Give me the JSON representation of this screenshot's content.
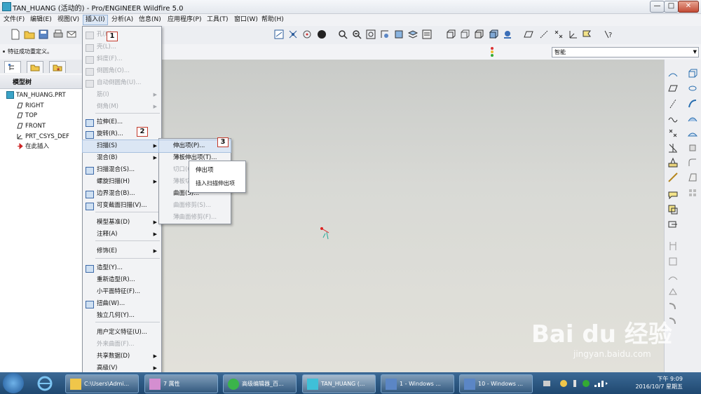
{
  "window": {
    "title": "TAN_HUANG (活动的) - Pro/ENGINEER Wildfire 5.0",
    "min": "—",
    "max": "□",
    "close": "✕"
  },
  "menubar": [
    "文件(F)",
    "编辑(E)",
    "视图(V)",
    "插入(I)",
    "分析(A)",
    "信息(N)",
    "应用程序(P)",
    "工具(T)",
    "窗口(W)",
    "帮助(H)"
  ],
  "status": {
    "message": "特征成功重定义。",
    "filter_value": "智能",
    "filter_arrow": "▼"
  },
  "model_tree": {
    "header": "模型树",
    "items": [
      "TAN_HUANG.PRT",
      "RIGHT",
      "TOP",
      "FRONT",
      "PRT_CSYS_DEF",
      "在此插入"
    ]
  },
  "insert_menu": {
    "items": [
      {
        "label": "孔(H)...",
        "disabled": true,
        "submenu": false,
        "icon": "hole-icon"
      },
      {
        "label": "壳(L)...",
        "disabled": true,
        "submenu": false,
        "icon": "shell-icon"
      },
      {
        "label": "斜度(F)...",
        "disabled": true,
        "submenu": false,
        "icon": "draft-icon"
      },
      {
        "label": "倒圆角(O)...",
        "disabled": true,
        "submenu": false,
        "icon": "round-icon"
      },
      {
        "label": "自动倒圆角(U)...",
        "disabled": true,
        "submenu": false,
        "icon": "auto-round-icon"
      },
      {
        "label": "筋(I)",
        "disabled": true,
        "submenu": true,
        "icon": ""
      },
      {
        "label": "倒角(M)",
        "disabled": true,
        "submenu": true,
        "icon": ""
      },
      {
        "label": "拉伸(E)...",
        "disabled": false,
        "submenu": false,
        "icon": "extrude-icon"
      },
      {
        "label": "旋转(R)...",
        "disabled": false,
        "submenu": false,
        "icon": "revolve-icon"
      },
      {
        "label": "扫描(S)",
        "disabled": false,
        "submenu": true,
        "icon": "",
        "highlight": true
      },
      {
        "label": "混合(B)",
        "disabled": false,
        "submenu": true,
        "icon": ""
      },
      {
        "label": "扫描混合(S)...",
        "disabled": false,
        "submenu": false,
        "icon": "swept-blend-icon"
      },
      {
        "label": "螺旋扫描(H)",
        "disabled": false,
        "submenu": true,
        "icon": ""
      },
      {
        "label": "边界混合(B)...",
        "disabled": false,
        "submenu": false,
        "icon": "boundary-blend-icon"
      },
      {
        "label": "可变截面扫描(V)...",
        "disabled": false,
        "submenu": false,
        "icon": "var-sweep-icon"
      },
      {
        "label": "模型基准(D)",
        "disabled": false,
        "submenu": true,
        "icon": ""
      },
      {
        "label": "注释(A)",
        "disabled": false,
        "submenu": true,
        "icon": ""
      },
      {
        "label": "修饰(E)",
        "disabled": false,
        "submenu": true,
        "icon": ""
      },
      {
        "label": "造型(Y)...",
        "disabled": false,
        "submenu": false,
        "icon": "style-icon"
      },
      {
        "label": "重新造型(R)...",
        "disabled": false,
        "submenu": false,
        "icon": ""
      },
      {
        "label": "小平面特征(F)...",
        "disabled": false,
        "submenu": false,
        "icon": ""
      },
      {
        "label": "扭曲(W)...",
        "disabled": false,
        "submenu": false,
        "icon": "warp-icon"
      },
      {
        "label": "独立几何(Y)...",
        "disabled": false,
        "submenu": false,
        "icon": ""
      },
      {
        "label": "用户定义特征(U)...",
        "disabled": false,
        "submenu": false,
        "icon": ""
      },
      {
        "label": "外来曲面(F)...",
        "disabled": true,
        "submenu": false,
        "icon": ""
      },
      {
        "label": "共享数据(D)",
        "disabled": false,
        "submenu": true,
        "icon": ""
      },
      {
        "label": "高级(V)",
        "disabled": false,
        "submenu": true,
        "icon": ""
      }
    ]
  },
  "sweep_menu": {
    "items": [
      {
        "label": "伸出项(P)...",
        "disabled": false
      },
      {
        "label": "薄板伸出项(T)...",
        "disabled": false
      },
      {
        "label": "切口(C)...",
        "disabled": true
      },
      {
        "label": "薄板切口(U)...",
        "disabled": true
      },
      {
        "label": "曲面(S)...",
        "disabled": false
      },
      {
        "label": "曲面修剪(S)...",
        "disabled": true
      },
      {
        "label": "薄曲面修剪(F)...",
        "disabled": true
      }
    ]
  },
  "tooltip": {
    "title": "伸出项",
    "desc": "插入扫描伸出项"
  },
  "annotations": [
    "1",
    "2",
    "3"
  ],
  "taskbar": {
    "buttons": [
      {
        "label": "C:\\Users\\Admi..."
      },
      {
        "label": "7 属性"
      },
      {
        "label": "高级编辑器_百..."
      },
      {
        "label": "TAN_HUANG (..."
      },
      {
        "label": "1 - Windows ..."
      },
      {
        "label": "10 - Windows ..."
      }
    ],
    "time": "下午 9:09",
    "date": "2016/10/7 星期五"
  },
  "watermark": {
    "brand": "Bai du 经验",
    "url": "jingyan.baidu.com"
  }
}
